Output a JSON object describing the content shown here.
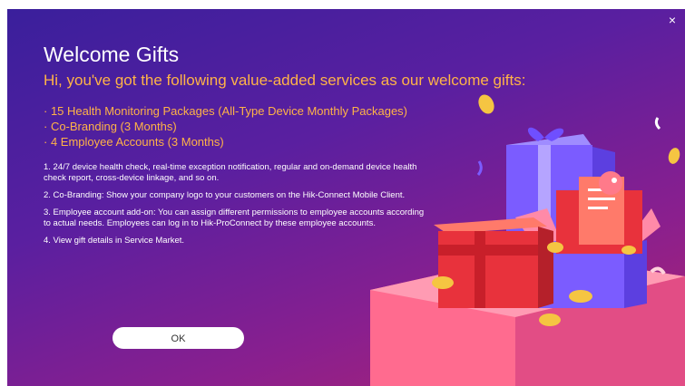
{
  "dialog": {
    "title": "Welcome Gifts",
    "subtitle": "Hi, you've got the following value-added services as our welcome gifts:",
    "close_label": "×",
    "services": [
      "· 15 Health Monitoring Packages (All-Type Device Monthly Packages)",
      "· Co-Branding (3 Months)",
      "· 4 Employee Accounts (3 Months)"
    ],
    "notes": [
      "1. 24/7 device health check, real-time exception notification, regular and on-demand device health check report, cross-device linkage, and so on.",
      "2. Co-Branding: Show your company logo to your customers on the Hik-Connect Mobile Client.",
      "3. Employee account add-on: You can assign different permissions to employee accounts according to actual needs. Employees can log in to Hik-ProConnect by these employee accounts.",
      "4. View gift details in Service Market."
    ],
    "ok_label": "OK"
  },
  "colors": {
    "background_start": "#3a1f9c",
    "background_end": "#b0256f",
    "accent_text": "#ffb347",
    "gift_purple": "#7b5cff",
    "gift_red": "#e8323c",
    "coin": "#f5c542"
  }
}
